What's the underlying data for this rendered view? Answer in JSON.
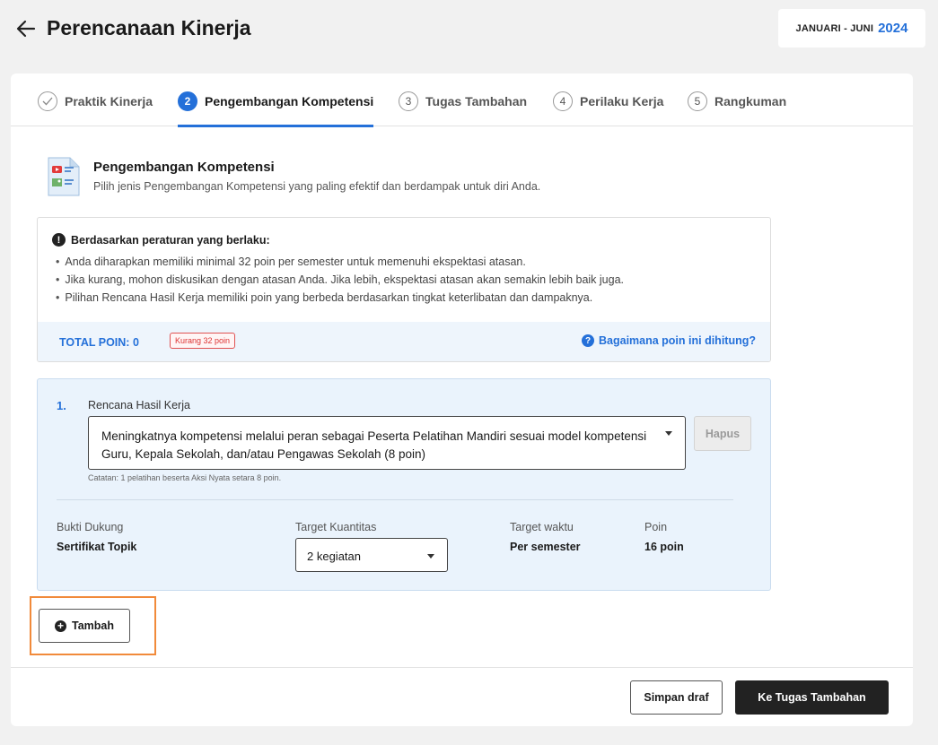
{
  "header": {
    "back_icon": "arrow-left-icon",
    "title": "Perencanaan Kinerja",
    "period_label": "JANUARI - JUNI",
    "period_year": "2024"
  },
  "stepper": {
    "steps": [
      {
        "marker": "✓",
        "label": "Praktik Kinerja",
        "state": "done"
      },
      {
        "marker": "2",
        "label": "Pengembangan Kompetensi",
        "state": "active"
      },
      {
        "marker": "3",
        "label": "Tugas Tambahan",
        "state": "upcoming"
      },
      {
        "marker": "4",
        "label": "Perilaku Kerja",
        "state": "upcoming"
      },
      {
        "marker": "5",
        "label": "Rangkuman",
        "state": "upcoming"
      }
    ]
  },
  "section": {
    "icon": "document-media-icon",
    "title": "Pengembangan Kompetensi",
    "subtitle": "Pilih jenis Pengembangan Kompetensi yang paling efektif dan berdampak untuk diri Anda."
  },
  "info": {
    "heading": "Berdasarkan peraturan yang berlaku:",
    "bullets": [
      "Anda diharapkan memiliki minimal 32 poin per semester untuk memenuhi ekspektasi atasan.",
      "Jika kurang, mohon diskusikan dengan atasan Anda. Jika lebih, ekspektasi atasan akan semakin lebih baik juga.",
      "Pilihan Rencana Hasil Kerja memiliki poin yang berbeda berdasarkan tingkat keterlibatan dan dampaknya."
    ],
    "total_label": "TOTAL POIN: 0",
    "shortfall_badge": "Kurang 32 poin",
    "help_link": "Bagaimana poin ini dihitung?"
  },
  "item": {
    "number": "1.",
    "field_label": "Rencana Hasil Kerja",
    "rhk_value": "Meningkatnya kompetensi melalui peran sebagai Peserta Pelatihan Mandiri sesuai model kompetensi Guru, Kepala Sekolah, dan/atau Pengawas Sekolah (8 poin)",
    "delete_label": "Hapus",
    "note": "Catatan: 1 pelatihan beserta Aksi Nyata setara 8 poin.",
    "bukti_label": "Bukti Dukung",
    "bukti_value": "Sertifikat Topik",
    "target_qty_label": "Target Kuantitas",
    "target_qty_value": "2 kegiatan",
    "target_time_label": "Target waktu",
    "target_time_value": "Per semester",
    "poin_label": "Poin",
    "poin_value": "16 poin"
  },
  "actions": {
    "add_label": "Tambah",
    "save_draft_label": "Simpan draf",
    "next_label": "Ke Tugas Tambahan"
  },
  "colors": {
    "accent": "#2470d9",
    "highlight_outline": "#f18a3a",
    "warning": "#e05252"
  }
}
